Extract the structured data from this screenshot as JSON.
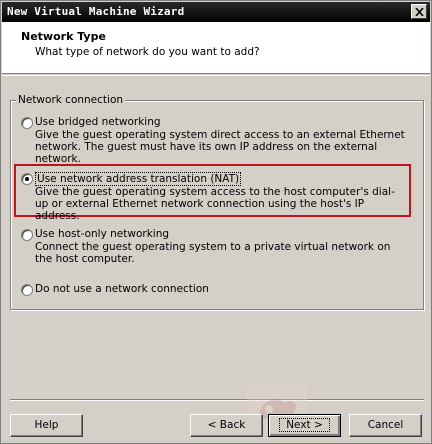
{
  "window": {
    "title": "New Virtual Machine Wizard"
  },
  "header": {
    "title": "Network Type",
    "subtitle": "What type of network do you want to add?"
  },
  "group": {
    "legend": "Network connection"
  },
  "options": [
    {
      "label": "Use bridged networking",
      "description": "Give the guest operating system direct access to an external Ethernet network. The guest must have its own IP address on the external network.",
      "selected": false
    },
    {
      "label": "Use network address translation (NAT)",
      "description": "Give the guest operating system access to the host computer's dial-up or external Ethernet network connection using the host's IP address.",
      "selected": true
    },
    {
      "label": "Use host-only networking",
      "description": "Connect the guest operating system to a private virtual network on the host computer.",
      "selected": false
    },
    {
      "label": "Do not use a network connection",
      "description": "",
      "selected": false
    }
  ],
  "buttons": {
    "help": "Help",
    "back": "< Back",
    "next": "Next >",
    "cancel": "Cancel"
  },
  "colors": {
    "highlight": "#c0141c",
    "titlebar": "#000000",
    "dialog": "#d4d0c8"
  },
  "icons": {
    "close": "close-icon",
    "watermark": "watermark-logo"
  }
}
